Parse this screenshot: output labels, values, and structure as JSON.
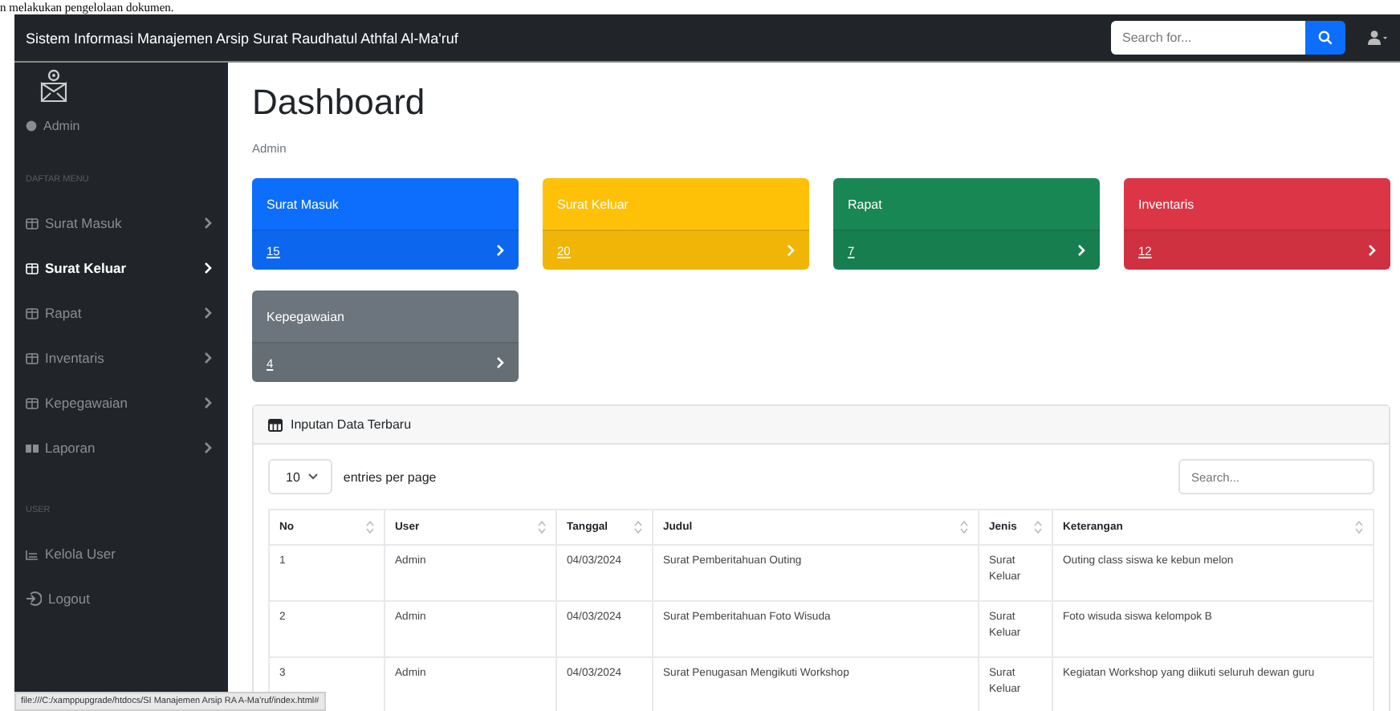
{
  "caption": "n melakukan pengelolaan dokumen.",
  "navbar": {
    "title": "Sistem Informasi Manajemen Arsip Surat Raudhatul Athfal Al-Ma'ruf",
    "search": {
      "placeholder": "Search for..."
    }
  },
  "sidebar": {
    "user": "Admin",
    "section": "DAFTAR MENU",
    "items": [
      {
        "label": "Surat Masuk",
        "kind": "table",
        "selected": false
      },
      {
        "label": "Surat Keluar",
        "kind": "table",
        "selected": true
      },
      {
        "label": "Rapat",
        "kind": "table",
        "selected": false
      },
      {
        "label": "Inventaris",
        "kind": "table",
        "selected": false
      },
      {
        "label": "Kepegawaian",
        "kind": "table",
        "selected": false
      },
      {
        "label": "Laporan",
        "kind": "chart",
        "selected": false
      }
    ],
    "user_section": "USER",
    "user_items": [
      {
        "label": "Kelola User",
        "kind": "users"
      },
      {
        "label": "Logout",
        "kind": "logout"
      }
    ]
  },
  "page": {
    "title": "Dashboard",
    "subtitle": "Admin"
  },
  "cards": [
    {
      "label": "Surat Masuk",
      "value": "15",
      "color": "#0d6efd"
    },
    {
      "label": "Surat Keluar",
      "value": "20",
      "color": "#ffc107"
    },
    {
      "label": "Rapat",
      "value": "7",
      "color": "#198754"
    },
    {
      "label": "Inventaris",
      "value": "12",
      "color": "#dc3545"
    },
    {
      "label": "Kepegawaian",
      "value": "4",
      "color": "#6c757d"
    }
  ],
  "table_card": {
    "title": "Inputan Data Terbaru",
    "per_page": "10",
    "per_page_label": "entries per page",
    "search": {
      "placeholder": "Search..."
    },
    "columns": [
      "No",
      "User",
      "Tanggal",
      "Judul",
      "Jenis",
      "Keterangan"
    ],
    "rows": [
      [
        "1",
        "Admin",
        "04/03/2024",
        "Surat Pemberitahuan Outing",
        "Surat Keluar",
        "Outing class siswa ke kebun melon"
      ],
      [
        "2",
        "Admin",
        "04/03/2024",
        "Surat Pemberitahuan Foto Wisuda",
        "Surat Keluar",
        "Foto wisuda siswa kelompok B"
      ],
      [
        "3",
        "Admin",
        "04/03/2024",
        "Surat Penugasan Mengikuti Workshop",
        "Surat Keluar",
        "Kegiatan Workshop yang diikuti seluruh dewan guru"
      ]
    ]
  },
  "status_url": "file:///C:/xamppupgrade/htdocs/SI Manajemen Arsip RA A-Ma'ruf/index.html#"
}
